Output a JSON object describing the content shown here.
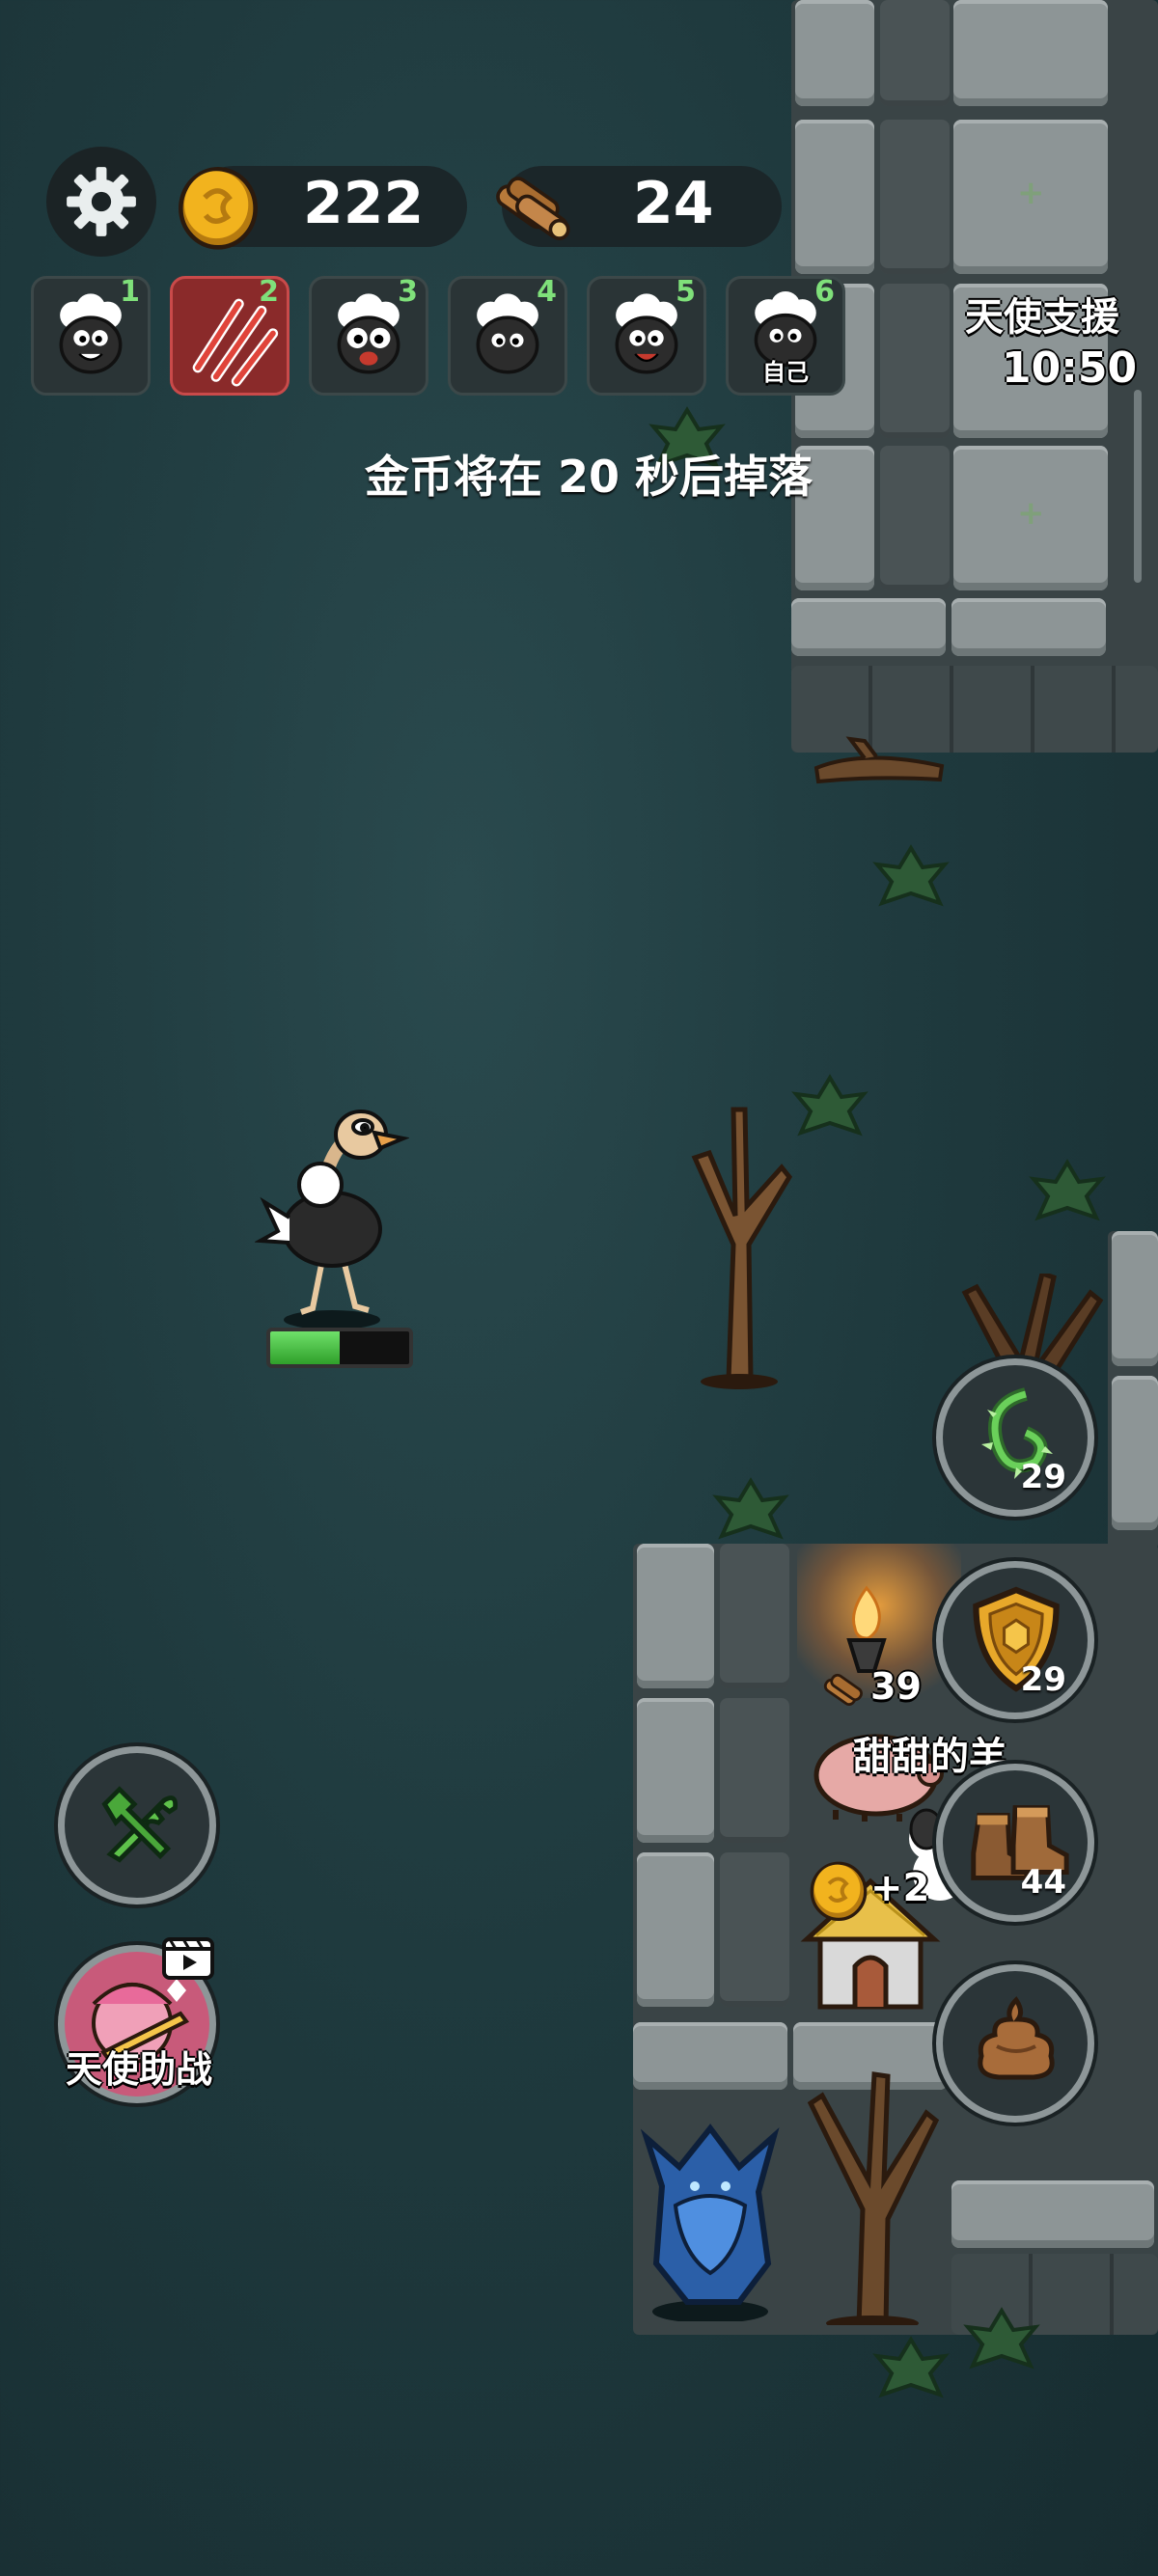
{
  "hud": {
    "settings_icon": "gear-icon",
    "gold": {
      "icon": "coin-icon",
      "value": "222"
    },
    "wood": {
      "icon": "wood-logs-icon",
      "value": "24"
    }
  },
  "players": [
    {
      "number": "1",
      "icon": "sheep-icon",
      "active": false
    },
    {
      "number": "2",
      "icon": "claw-scratch-icon",
      "active": true
    },
    {
      "number": "3",
      "icon": "sheep-icon",
      "active": false
    },
    {
      "number": "4",
      "icon": "sheep-icon",
      "active": false
    },
    {
      "number": "5",
      "icon": "sheep-icon",
      "active": false
    },
    {
      "number": "6",
      "icon": "sheep-icon",
      "active": false,
      "label": "自己"
    }
  ],
  "angel_support": {
    "label": "天使支援",
    "timer": "10:50"
  },
  "message": "金币将在 20 秒后掉落",
  "player_health_fraction": 0.5,
  "base": {
    "wood_cost": "39",
    "name": "甜甜的羊",
    "coin_bonus": "+2"
  },
  "action_buttons": [
    {
      "name": "thorn-vine",
      "icon": "thorn-vine-icon",
      "count": "29"
    },
    {
      "name": "shield",
      "icon": "shield-icon",
      "count": "29"
    },
    {
      "name": "boots",
      "icon": "boots-icon",
      "count": "44"
    },
    {
      "name": "poop",
      "icon": "poop-icon",
      "count": ""
    }
  ],
  "left_buttons": {
    "build_icon": "wrench-hammer-icon",
    "angel_assist": {
      "label": "天使助战",
      "icon": "video-ad-icon"
    }
  },
  "colors": {
    "active_slot": "#8a2a2a",
    "accent_green": "#7fe07a",
    "gold": "#f2b31e"
  }
}
